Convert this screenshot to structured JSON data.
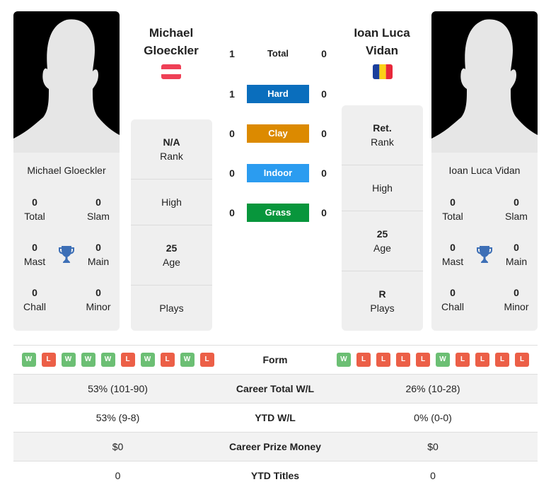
{
  "player_left": {
    "name": "Michael Gloeckler",
    "header_name_line1": "Michael",
    "header_name_line2": "Gloeckler",
    "flag": "austria-flag",
    "flag_colors": [
      "#ef4056",
      "#ffffff",
      "#ef4056"
    ],
    "titles": {
      "total": {
        "value": "0",
        "label": "Total"
      },
      "slam": {
        "value": "0",
        "label": "Slam"
      },
      "mast": {
        "value": "0",
        "label": "Mast"
      },
      "main": {
        "value": "0",
        "label": "Main"
      },
      "chall": {
        "value": "0",
        "label": "Chall"
      },
      "minor": {
        "value": "0",
        "label": "Minor"
      }
    },
    "info": {
      "rank": {
        "value": "N/A",
        "label": "Rank"
      },
      "high": {
        "value": "",
        "label": "High"
      },
      "age": {
        "value": "25",
        "label": "Age"
      },
      "plays": {
        "value": "",
        "label": "Plays"
      }
    },
    "form": [
      "W",
      "L",
      "W",
      "W",
      "W",
      "L",
      "W",
      "L",
      "W",
      "L"
    ],
    "career_wl": "53% (101-90)",
    "ytd_wl": "53% (9-8)",
    "prize": "$0",
    "ytd_titles": "0"
  },
  "player_right": {
    "name": "Ioan Luca Vidan",
    "header_name_line1": "Ioan Luca",
    "header_name_line2": "Vidan",
    "flag": "romania-flag",
    "flag_colors": [
      "#1b3f9c",
      "#fcd116",
      "#e8283a"
    ],
    "titles": {
      "total": {
        "value": "0",
        "label": "Total"
      },
      "slam": {
        "value": "0",
        "label": "Slam"
      },
      "mast": {
        "value": "0",
        "label": "Mast"
      },
      "main": {
        "value": "0",
        "label": "Main"
      },
      "chall": {
        "value": "0",
        "label": "Chall"
      },
      "minor": {
        "value": "0",
        "label": "Minor"
      }
    },
    "info": {
      "rank": {
        "value": "Ret.",
        "label": "Rank"
      },
      "high": {
        "value": "",
        "label": "High"
      },
      "age": {
        "value": "25",
        "label": "Age"
      },
      "plays": {
        "value": "R",
        "label": "Plays"
      }
    },
    "form": [
      "W",
      "L",
      "L",
      "L",
      "L",
      "W",
      "L",
      "L",
      "L",
      "L"
    ],
    "career_wl": "26% (10-28)",
    "ytd_wl": "0% (0-0)",
    "prize": "$0",
    "ytd_titles": "0"
  },
  "h2h": [
    {
      "label": "Total",
      "left": "1",
      "right": "0",
      "color": ""
    },
    {
      "label": "Hard",
      "left": "1",
      "right": "0",
      "color": "#0a6ebd"
    },
    {
      "label": "Clay",
      "left": "0",
      "right": "0",
      "color": "#dc8a00"
    },
    {
      "label": "Indoor",
      "left": "0",
      "right": "0",
      "color": "#2b9cf0"
    },
    {
      "label": "Grass",
      "left": "0",
      "right": "0",
      "color": "#08963c"
    }
  ],
  "comparison_labels": {
    "form": "Form",
    "career_wl": "Career Total W/L",
    "ytd_wl": "YTD W/L",
    "prize": "Career Prize Money",
    "ytd_titles": "YTD Titles"
  }
}
